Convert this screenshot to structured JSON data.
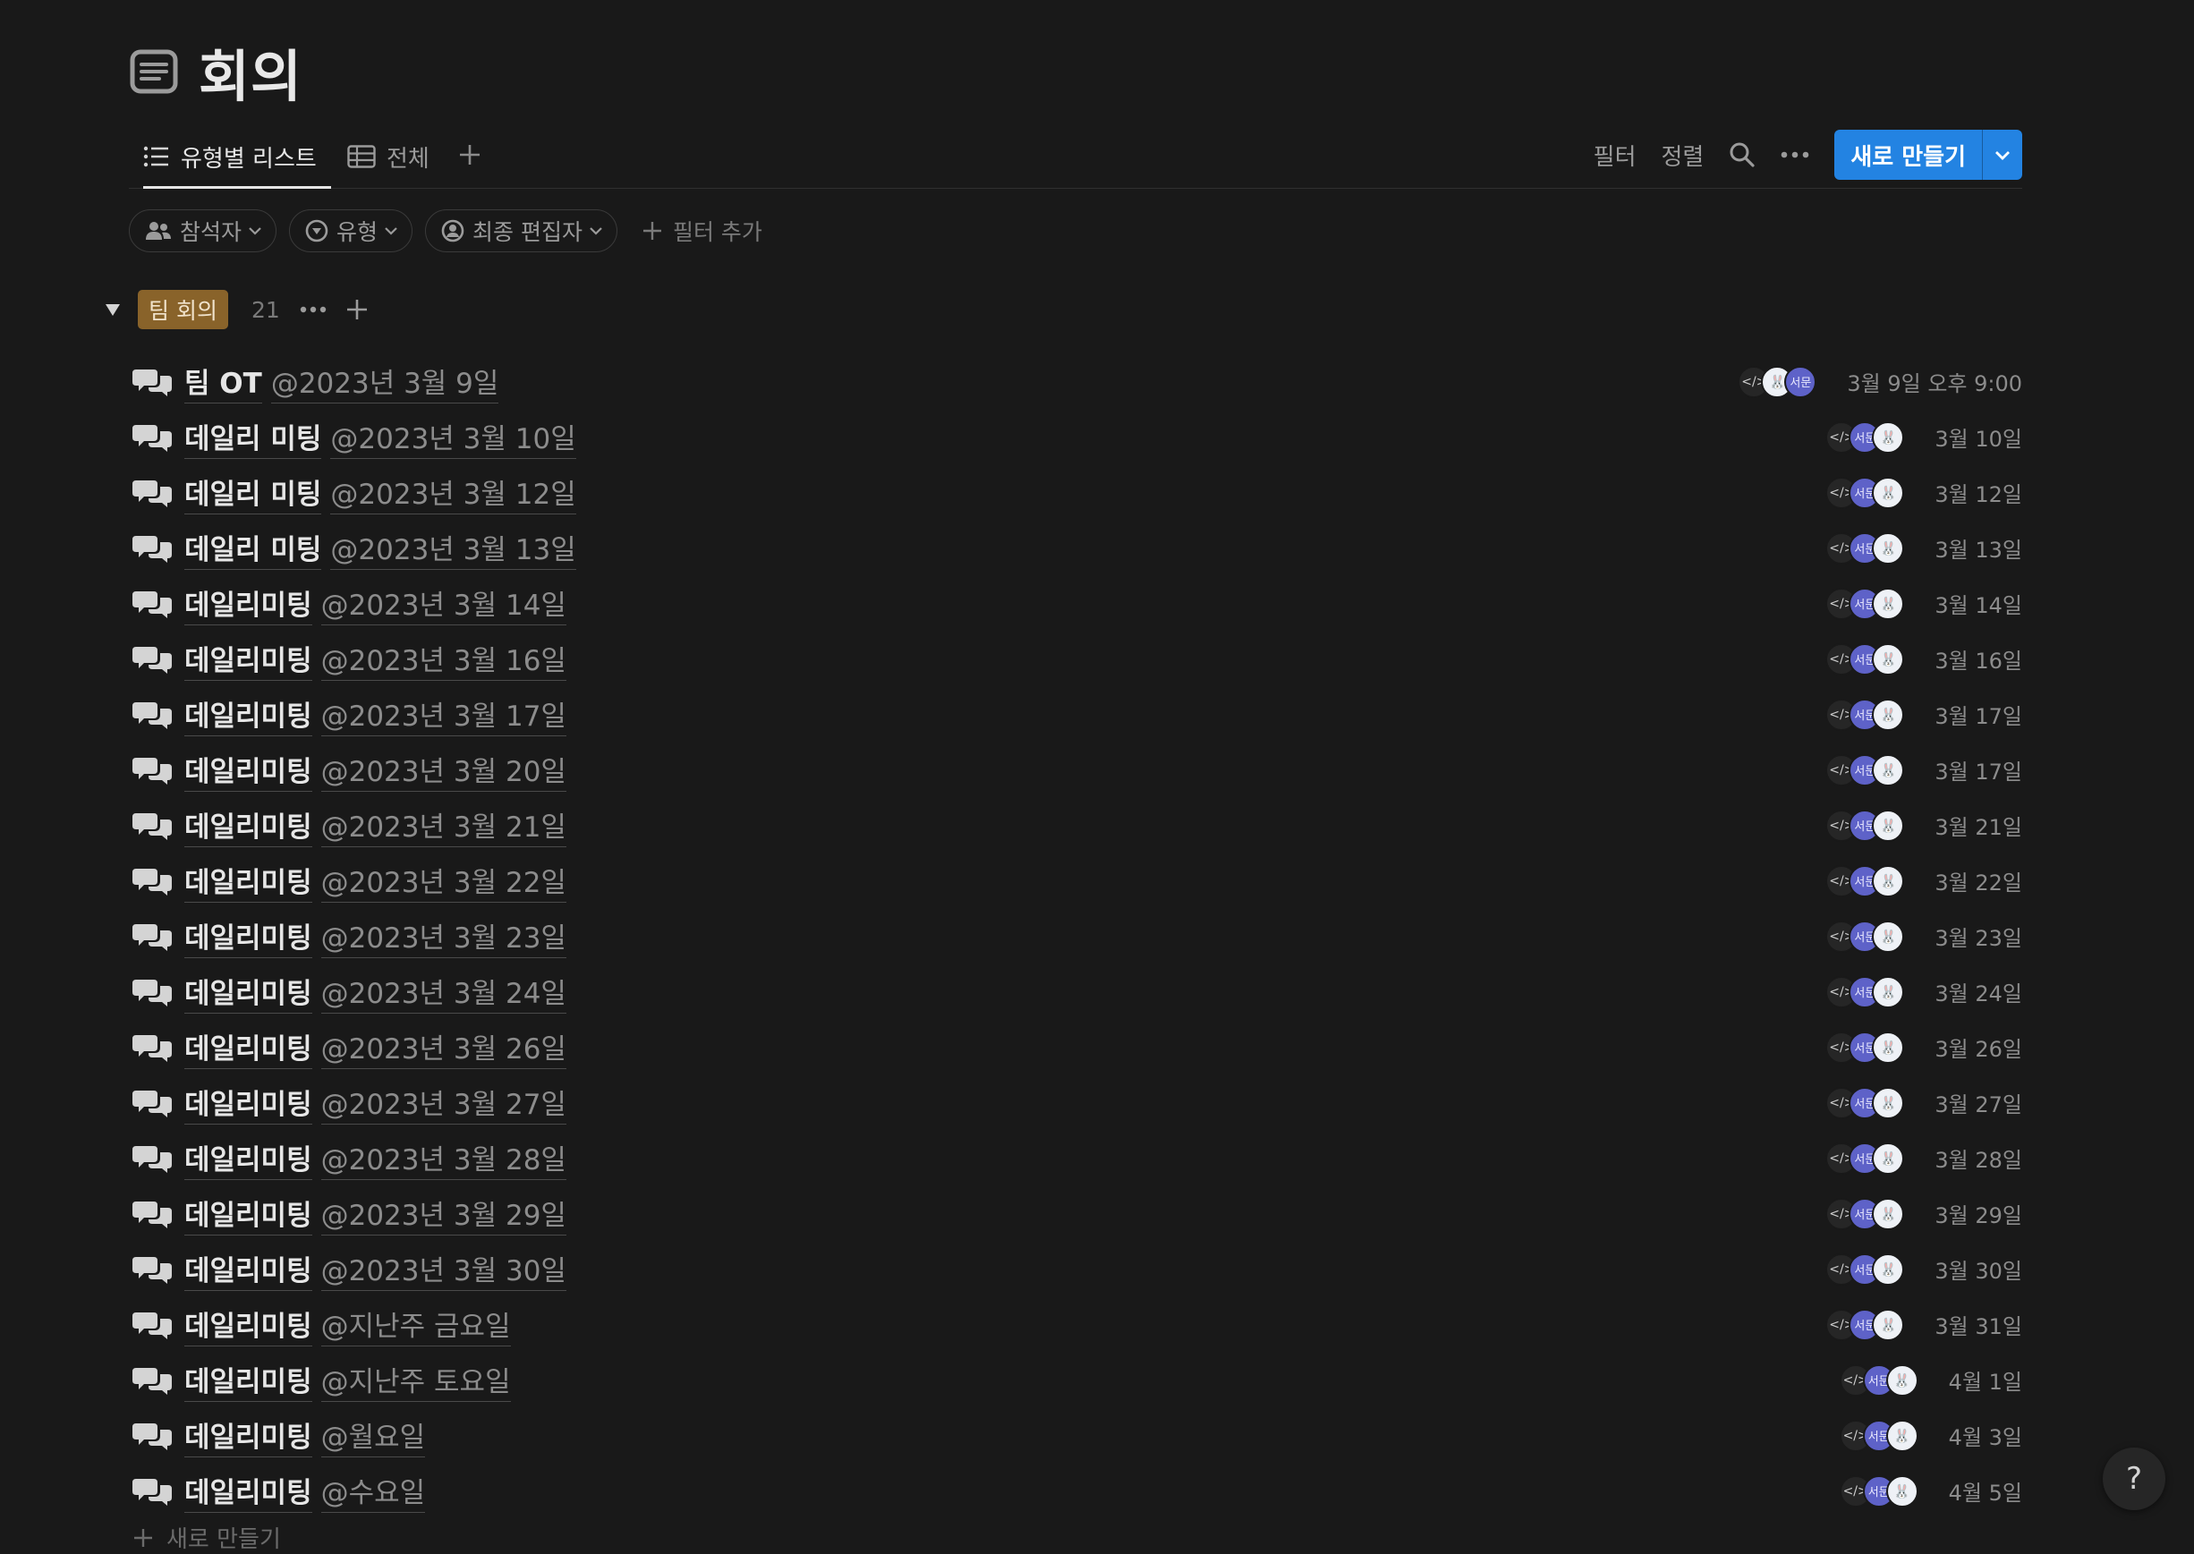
{
  "page": {
    "title": "회의",
    "icon": "document-lines-icon"
  },
  "views": {
    "tabs": [
      {
        "label": "유형별 리스트",
        "icon": "list-icon",
        "active": true
      },
      {
        "label": "전체",
        "icon": "table-icon",
        "active": false
      }
    ]
  },
  "toolbar": {
    "filter_label": "필터",
    "sort_label": "정렬",
    "new_label": "새로 만들기",
    "accent": "#2383e2"
  },
  "filters": {
    "chips": [
      {
        "label": "참석자",
        "icon": "people-icon"
      },
      {
        "label": "유형",
        "icon": "select-circle-icon"
      },
      {
        "label": "최종 편집자",
        "icon": "person-circle-icon"
      }
    ],
    "add_label": "필터 추가"
  },
  "group": {
    "label": "팀 회의",
    "count": "21",
    "tag_color": "#89632a"
  },
  "rows": [
    {
      "title": "팀 OT",
      "date": "@2023년 3월 9일",
      "edited": "3월 9일 오후 9:00"
    },
    {
      "title": "데일리 미팅",
      "date": "@2023년 3월 10일",
      "edited": "3월 10일"
    },
    {
      "title": "데일리 미팅",
      "date": "@2023년 3월 12일",
      "edited": "3월 12일"
    },
    {
      "title": "데일리 미팅",
      "date": "@2023년 3월 13일",
      "edited": "3월 13일"
    },
    {
      "title": "데일리미팅",
      "date": "@2023년 3월 14일",
      "edited": "3월 14일"
    },
    {
      "title": "데일리미팅",
      "date": "@2023년 3월 16일",
      "edited": "3월 16일"
    },
    {
      "title": "데일리미팅",
      "date": "@2023년 3월 17일",
      "edited": "3월 17일"
    },
    {
      "title": "데일리미팅",
      "date": "@2023년 3월 20일",
      "edited": "3월 17일"
    },
    {
      "title": "데일리미팅",
      "date": "@2023년 3월 21일",
      "edited": "3월 21일"
    },
    {
      "title": "데일리미팅",
      "date": "@2023년 3월 22일",
      "edited": "3월 22일"
    },
    {
      "title": "데일리미팅",
      "date": "@2023년 3월 23일",
      "edited": "3월 23일"
    },
    {
      "title": "데일리미팅",
      "date": "@2023년 3월 24일",
      "edited": "3월 24일"
    },
    {
      "title": "데일리미팅",
      "date": "@2023년 3월 26일",
      "edited": "3월 26일"
    },
    {
      "title": "데일리미팅",
      "date": "@2023년 3월 27일",
      "edited": "3월 27일"
    },
    {
      "title": "데일리미팅",
      "date": "@2023년 3월 28일",
      "edited": "3월 28일"
    },
    {
      "title": "데일리미팅",
      "date": "@2023년 3월 29일",
      "edited": "3월 29일"
    },
    {
      "title": "데일리미팅",
      "date": "@2023년 3월 30일",
      "edited": "3월 30일"
    },
    {
      "title": "데일리미팅",
      "date": "@지난주 금요일",
      "edited": "3월 31일"
    },
    {
      "title": "데일리미팅",
      "date": "@지난주 토요일",
      "edited": "4월 1일"
    },
    {
      "title": "데일리미팅",
      "date": "@월요일",
      "edited": "4월 3일"
    },
    {
      "title": "데일리미팅",
      "date": "@수요일",
      "edited": "4월 5일"
    }
  ],
  "avatar_initial": "서문",
  "new_item_label": "새로 만들기",
  "help_label": "?"
}
